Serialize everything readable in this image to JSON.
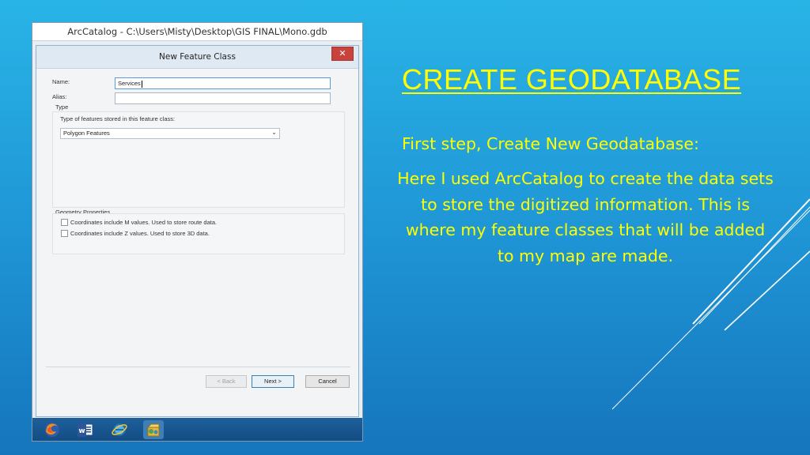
{
  "slide": {
    "title": "CREATE GEODATABASE",
    "subtitle": "First step, Create New Geodatabase:",
    "body": "Here I used ArcCatalog to create the data sets to store the digitized information. This is where my feature classes that will be added to my map are made."
  },
  "app": {
    "window_title": "ArcCatalog - C:\\Users\\Misty\\Desktop\\GIS FINAL\\Mono.gdb"
  },
  "dialog": {
    "title": "New Feature Class",
    "close_glyph": "✕",
    "name_label": "Name:",
    "name_value": "Services",
    "alias_label": "Alias:",
    "alias_value": "",
    "type_group_label": "Type",
    "type_prompt": "Type of features stored in this feature class:",
    "type_selected": "Polygon Features",
    "geometry_group_label": "Geometry Properties",
    "checkbox_m": "Coordinates include M values. Used to store route data.",
    "checkbox_z": "Coordinates include Z values. Used to store 3D data.",
    "checkbox_m_checked": false,
    "checkbox_z_checked": false,
    "back_label": "< Back",
    "next_label": "Next >",
    "cancel_label": "Cancel"
  },
  "taskbar": {
    "icons": [
      "firefox-icon",
      "word-icon",
      "internet-explorer-icon",
      "arccatalog-icon"
    ]
  },
  "colors": {
    "background_top": "#29b4e6",
    "background_bottom": "#1675bd",
    "text_accent": "#ffff00"
  }
}
